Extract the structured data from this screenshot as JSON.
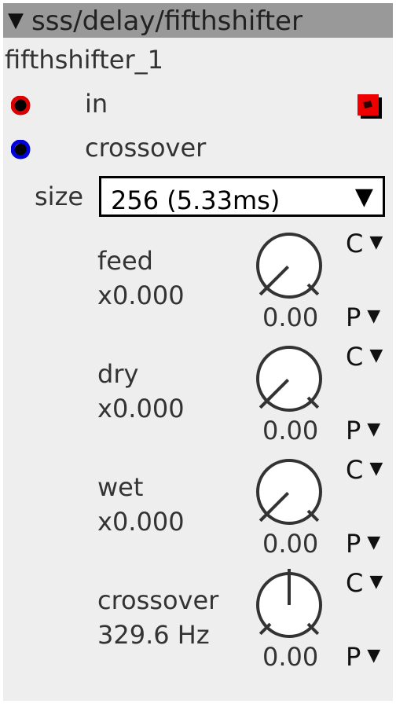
{
  "module": {
    "title": "sss/delay/fifthshifter",
    "title_arrow": "▼",
    "instance": "fifthshifter_1"
  },
  "ports": [
    {
      "label": "in",
      "color": "#dd0000"
    },
    {
      "label": "crossover",
      "color": "#0000dd"
    }
  ],
  "size": {
    "label": "size",
    "value": "256 (5.33ms)",
    "arrow": "▼"
  },
  "params": [
    {
      "name": "feed",
      "value": "x0.000",
      "readout": "0.00",
      "knob_fraction": 0.0,
      "mode_top": "C",
      "mode_bottom": "P",
      "arrow": "▼"
    },
    {
      "name": "dry",
      "value": "x0.000",
      "readout": "0.00",
      "knob_fraction": 0.0,
      "mode_top": "C",
      "mode_bottom": "P",
      "arrow": "▼"
    },
    {
      "name": "wet",
      "value": "x0.000",
      "readout": "0.00",
      "knob_fraction": 0.0,
      "mode_top": "C",
      "mode_bottom": "P",
      "arrow": "▼"
    },
    {
      "name": "crossover",
      "value": "329.6 Hz",
      "readout": "0.00",
      "knob_fraction": 0.5,
      "mode_top": "C",
      "mode_bottom": "P",
      "arrow": "▼"
    }
  ]
}
